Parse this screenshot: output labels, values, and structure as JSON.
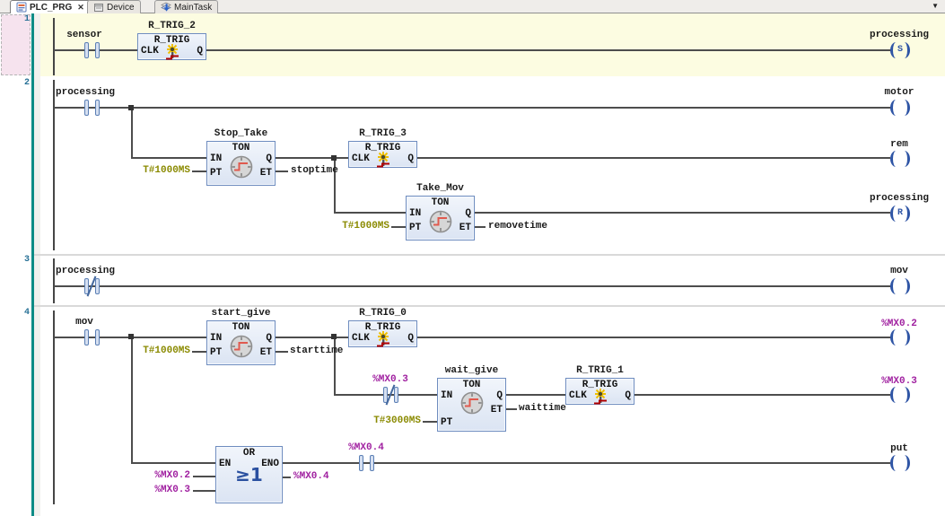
{
  "tab_bar": {
    "tabs": [
      {
        "label": "PLC_PRG",
        "close": "✕"
      },
      {
        "label": "Device"
      },
      {
        "label": "MainTask"
      }
    ],
    "overflow": "▼"
  },
  "pins": {
    "in": "IN",
    "pt": "PT",
    "q": "Q",
    "et": "ET",
    "clk": "CLK",
    "en": "EN",
    "eno": "ENO"
  },
  "networks": [
    {
      "number": "1",
      "contact": "sensor",
      "trig": {
        "instance": "R_TRIG_2",
        "type": "R_TRIG"
      },
      "coil": {
        "label": "processing",
        "mod": "S"
      }
    },
    {
      "number": "2",
      "contact": "processing",
      "coil_motor": "motor",
      "ton_stop": {
        "instance": "Stop_Take",
        "type": "TON",
        "pt": "T#1000MS",
        "et": "stoptime"
      },
      "trig": {
        "instance": "R_TRIG_3",
        "type": "R_TRIG"
      },
      "coil_rem": "rem",
      "ton_take": {
        "instance": "Take_Mov",
        "type": "TON",
        "pt": "T#1000MS",
        "et": "removetime"
      },
      "coil_reset": {
        "label": "processing",
        "mod": "R"
      }
    },
    {
      "number": "3",
      "contact": "processing",
      "coil": "mov"
    },
    {
      "number": "4",
      "contact": "mov",
      "ton_start": {
        "instance": "start_give",
        "type": "TON",
        "pt": "T#1000MS",
        "et": "starttime"
      },
      "trig0": {
        "instance": "R_TRIG_0",
        "type": "R_TRIG"
      },
      "coil_mx02": "%MX0.2",
      "contact_mx03": "%MX0.3",
      "ton_wait": {
        "instance": "wait_give",
        "type": "TON",
        "pt": "T#3000MS",
        "et": "waittime"
      },
      "trig1": {
        "instance": "R_TRIG_1",
        "type": "R_TRIG"
      },
      "coil_mx03": "%MX0.3",
      "or_block": {
        "type": "OR",
        "symbol": "≥1",
        "in1": "%MX0.2",
        "in2": "%MX0.3",
        "out": "%MX0.4"
      },
      "contact_mx04": "%MX0.4",
      "coil_put": "put"
    }
  ]
}
